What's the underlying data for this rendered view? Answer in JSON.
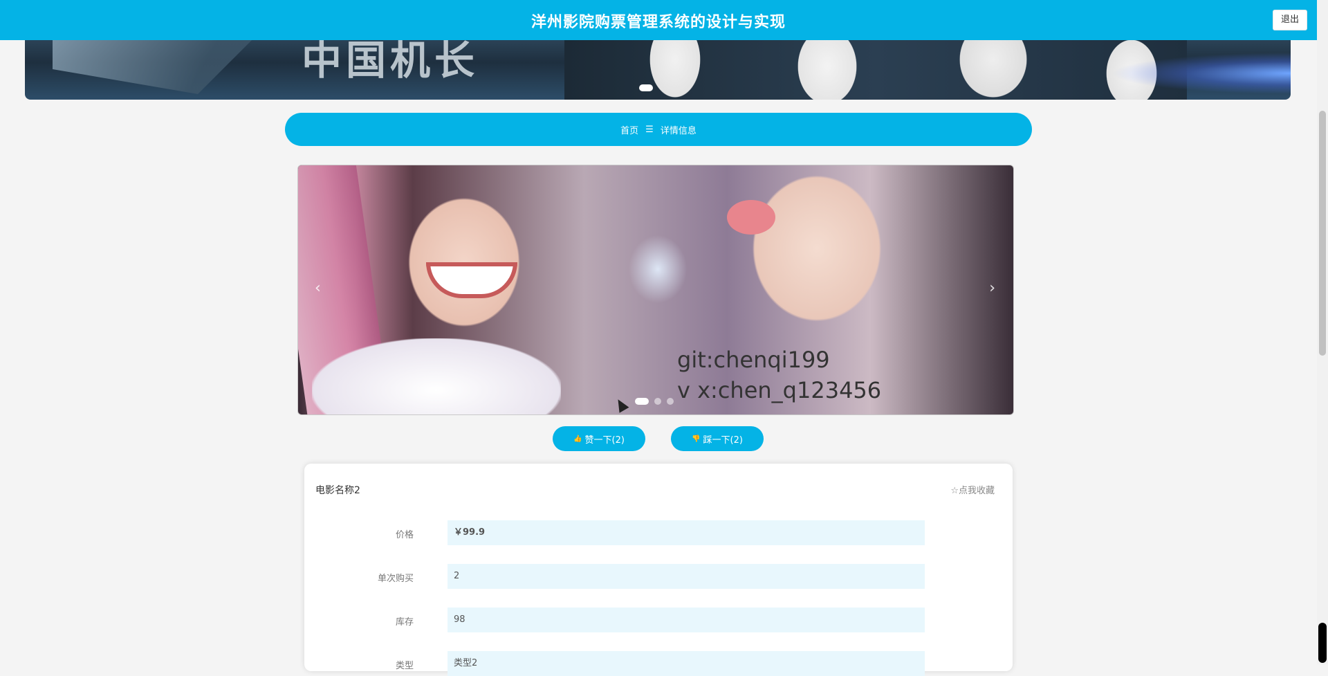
{
  "header": {
    "title": "洋州影院购票管理系统的设计与实现",
    "logout_label": "退出"
  },
  "breadcrumb": {
    "home": "首页",
    "separator": "☰",
    "current": "详情信息"
  },
  "carousel": {
    "watermark_line1": "git:chenqi199",
    "watermark_line2": "v x:chen_q123456",
    "prev": "‹",
    "next": "›",
    "slide_count": 3,
    "active_slide": 1
  },
  "votes": {
    "up_icon": "👍",
    "up_label": "赞一下(2)",
    "down_icon": "👎",
    "down_label": "踩一下(2)"
  },
  "detail": {
    "name": "电影名称2",
    "favorite_label": "☆点我收藏",
    "fields": [
      {
        "label": "价格",
        "value": "￥99.9"
      },
      {
        "label": "单次购买",
        "value": "2"
      },
      {
        "label": "库存",
        "value": "98"
      },
      {
        "label": "类型",
        "value": "类型2"
      }
    ]
  },
  "colors": {
    "primary": "#04b3e6",
    "field_bg": "#e8f7fd"
  }
}
